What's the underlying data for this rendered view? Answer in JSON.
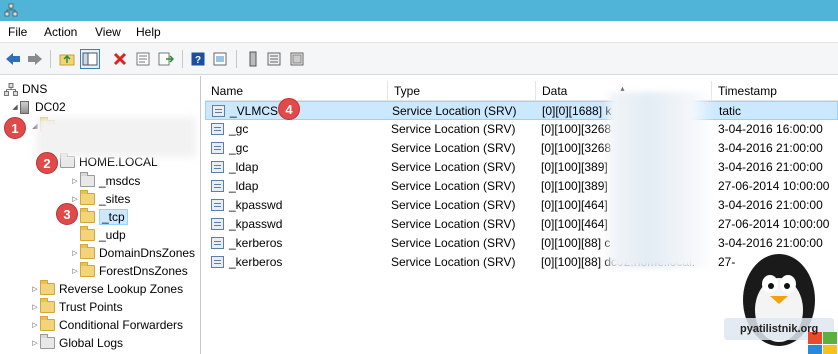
{
  "window": {
    "icon": "dns-app-icon"
  },
  "menu": [
    "File",
    "Action",
    "View",
    "Help"
  ],
  "tree": {
    "root": "DNS",
    "server": "DC02",
    "forward_zones_label_hidden": "Forward Lookup Zones",
    "zone": "HOME.LOCAL",
    "zone_children": [
      "_msdcs",
      "_sites",
      "_tcp",
      "_udp",
      "DomainDnsZones",
      "ForestDnsZones"
    ],
    "server_children": [
      "Reverse Lookup Zones",
      "Trust Points",
      "Conditional Forwarders",
      "Global Logs"
    ]
  },
  "columns": [
    "Name",
    "Type",
    "Data",
    "Timestamp"
  ],
  "records": [
    {
      "name": "_VLMCS",
      "type": "Service Location (SRV)",
      "data": "[0][0][1688] k",
      "timestamp": "tatic"
    },
    {
      "name": "_gc",
      "type": "Service Location (SRV)",
      "data": "[0][100][3268",
      "timestamp": "3-04-2016 16:00:00"
    },
    {
      "name": "_gc",
      "type": "Service Location (SRV)",
      "data": "[0][100][3268",
      "timestamp": "3-04-2016 21:00:00"
    },
    {
      "name": "_ldap",
      "type": "Service Location (SRV)",
      "data": "[0][100][389]",
      "timestamp": "3-04-2016 21:00:00"
    },
    {
      "name": "_ldap",
      "type": "Service Location (SRV)",
      "data": "[0][100][389]",
      "timestamp": "27-06-2014 10:00:00"
    },
    {
      "name": "_kpasswd",
      "type": "Service Location (SRV)",
      "data": "[0][100][464]",
      "timestamp": "3-04-2016 21:00:00"
    },
    {
      "name": "_kpasswd",
      "type": "Service Location (SRV)",
      "data": "[0][100][464]",
      "timestamp": "27-06-2014 10:00:00"
    },
    {
      "name": "_kerberos",
      "type": "Service Location (SRV)",
      "data": "[0][100][88] c",
      "timestamp": "3-04-2016 21:00:00"
    },
    {
      "name": "_kerberos",
      "type": "Service Location (SRV)",
      "data": "[0][100][88] dc02.home.local.",
      "timestamp": "27-"
    }
  ],
  "badges": [
    "1",
    "2",
    "3",
    "4"
  ],
  "watermark": "pyatilistnik.org",
  "colors": {
    "titlebar": "#4fb4d8",
    "selection": "#cce8ff",
    "badge": "#e04a4a"
  }
}
